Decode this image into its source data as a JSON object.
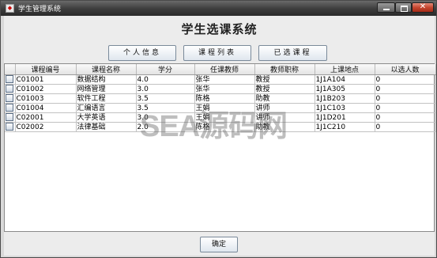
{
  "window": {
    "title": "学生管理系统",
    "icon_glyph": "◆"
  },
  "heading": "学生选课系统",
  "buttons": {
    "personal_info": "个人信息",
    "course_list": "课程列表",
    "selected_courses": "已选课程",
    "confirm": "确定"
  },
  "table": {
    "columns": [
      "",
      "课程编号",
      "课程名称",
      "学分",
      "任课教师",
      "教师职称",
      "上课地点",
      "以选人数"
    ],
    "rows": [
      [
        "C01001",
        "数据结构",
        "4.0",
        "张华",
        "教授",
        "1J1A104",
        "0"
      ],
      [
        "C01002",
        "网络管理",
        "3.0",
        "张华",
        "教授",
        "1J1A305",
        "0"
      ],
      [
        "C01003",
        "软件工程",
        "3.5",
        "陈格",
        "助教",
        "1J1B203",
        "0"
      ],
      [
        "C01004",
        "汇编语言",
        "3.5",
        "王娟",
        "讲师",
        "1J1C103",
        "0"
      ],
      [
        "C02001",
        "大学英语",
        "3.0",
        "王娟",
        "讲师",
        "1J1D201",
        "0"
      ],
      [
        "C02002",
        "法律基础",
        "2.0",
        "陈格",
        "助教",
        "1J1C210",
        "0"
      ]
    ]
  },
  "watermark": "SEA源码网"
}
